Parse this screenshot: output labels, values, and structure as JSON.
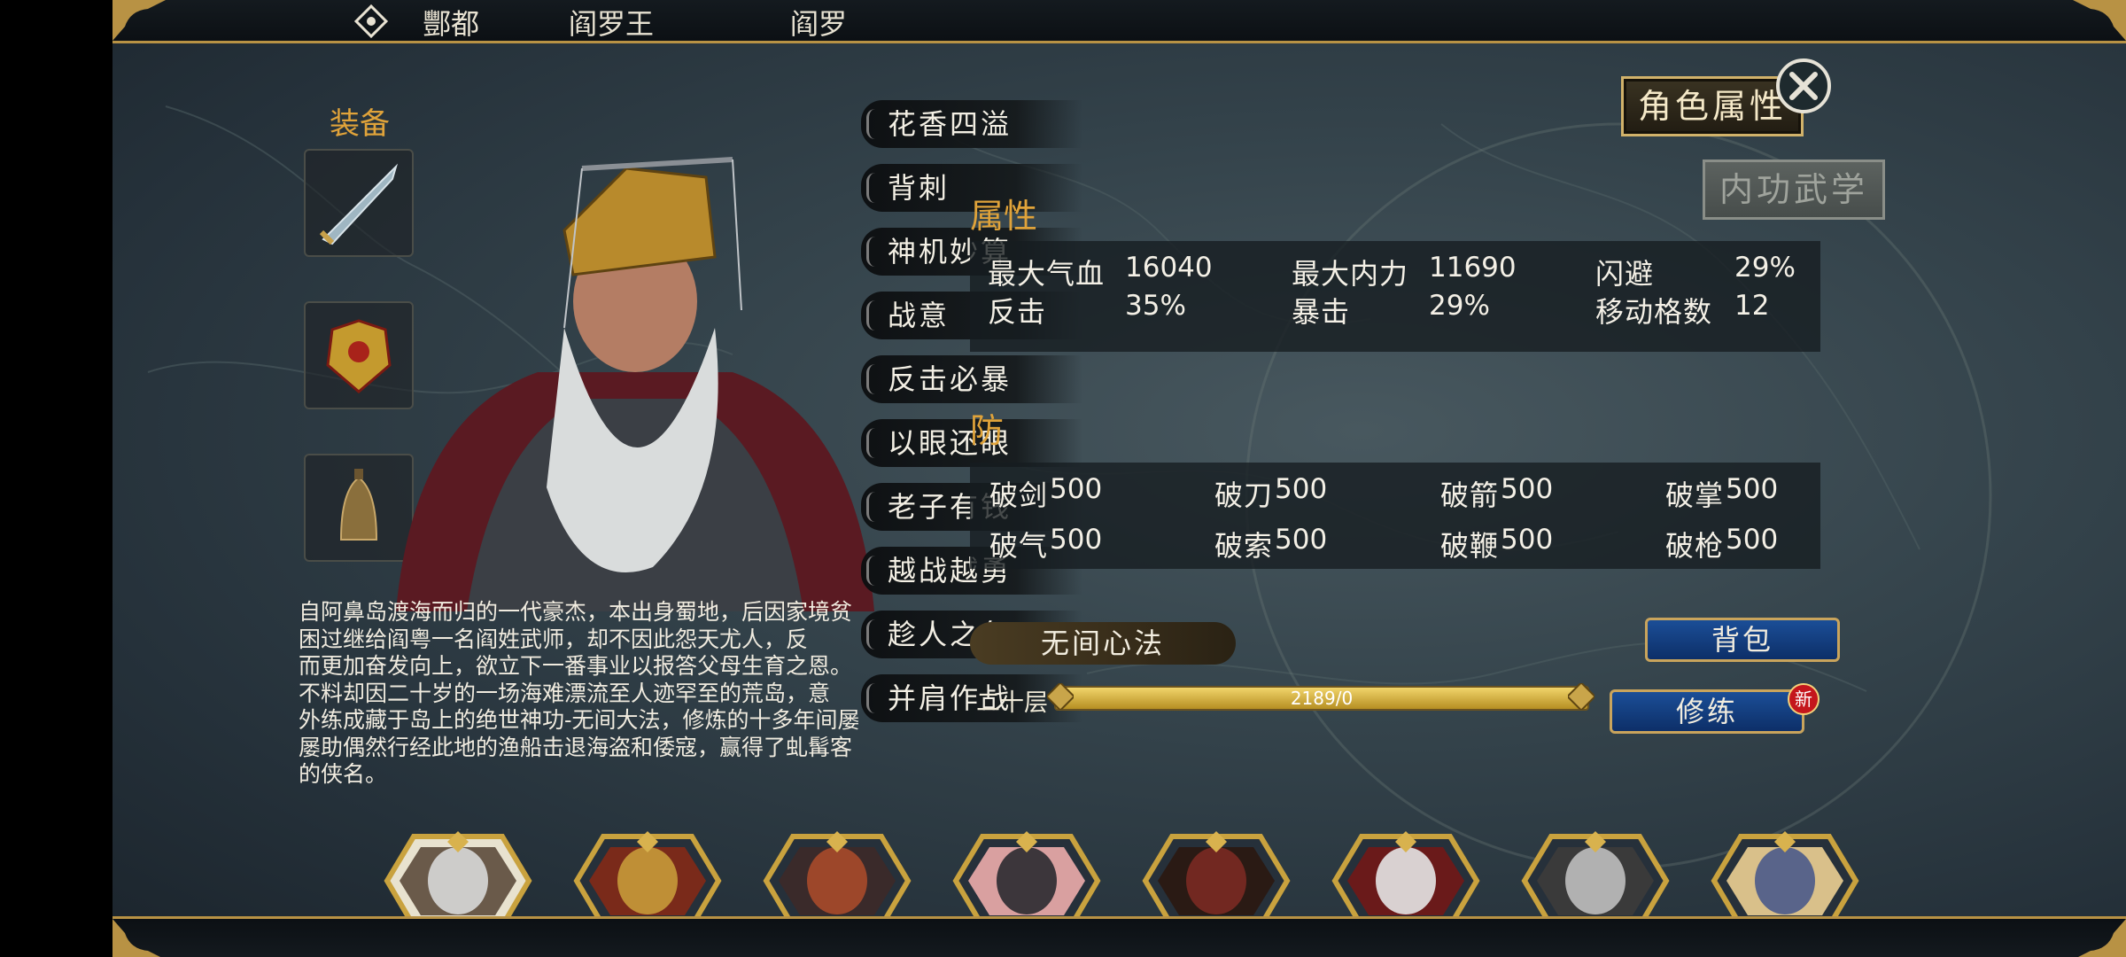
{
  "breadcrumb": {
    "items": [
      "酆都",
      "阎罗王",
      "阎罗"
    ]
  },
  "tabs": {
    "attributes_label": "角色属性",
    "martial_label": "内功武学"
  },
  "equipment": {
    "title": "装备",
    "slots": [
      "sword-icon",
      "armor-icon",
      "bell-icon"
    ]
  },
  "skills": [
    "花香四溢",
    "背刺",
    "神机妙算",
    "战意",
    "反击必暴",
    "以眼还眼",
    "老子有钱",
    "越战越勇",
    "趁人之危",
    "并肩作战"
  ],
  "description": "自阿鼻岛渡海而归的一代豪杰，本出身蜀地，后因家境贫困过继给阎粤一名阎姓武师，却不因此怨天尤人，反而更加奋发向上，欲立下一番事业以报答父母生育之恩。不料却因二十岁的一场海难漂流至人迹罕至的荒岛，意外练成藏于岛上的绝世神功-无间大法，修炼的十多年间屡屡助偶然行经此地的渔船击退海盗和倭寇，赢得了虬髯客的侠名。",
  "description_lines": [
    "自阿鼻岛渡海而归的一代豪杰，本出身蜀地，后因家境贫",
    "困过继给阎粤一名阎姓武师，却不因此怨天尤人，反",
    "而更加奋发向上，欲立下一番事业以报答父母生育之恩。",
    "不料却因二十岁的一场海难漂流至人迹罕至的荒岛，意",
    "外练成藏于岛上的绝世神功-无间大法，修炼的十多年间屡",
    "屡助偶然行经此地的渔船击退海盗和倭寇，赢得了虬髯客",
    "的侠名。"
  ],
  "attributes": {
    "title": "属性",
    "rows": [
      [
        {
          "label": "最大气血",
          "value": "16040"
        },
        {
          "label": "最大内力",
          "value": "11690"
        },
        {
          "label": "闪避",
          "value": "29%"
        }
      ],
      [
        {
          "label": "反击",
          "value": "35%"
        },
        {
          "label": "暴击",
          "value": "29%"
        },
        {
          "label": "移动格数",
          "value": "12"
        }
      ]
    ]
  },
  "defense": {
    "title": "防",
    "rows": [
      [
        {
          "label": "破剑",
          "value": "500"
        },
        {
          "label": "破刀",
          "value": "500"
        },
        {
          "label": "破箭",
          "value": "500"
        },
        {
          "label": "破掌",
          "value": "500"
        }
      ],
      [
        {
          "label": "破气",
          "value": "500"
        },
        {
          "label": "破索",
          "value": "500"
        },
        {
          "label": "破鞭",
          "value": "500"
        },
        {
          "label": "破枪",
          "value": "500"
        }
      ]
    ]
  },
  "inner_art": {
    "name": "无间心法",
    "level_label": "二十层",
    "progress_text": "2189/0",
    "progress_fraction": 1.0
  },
  "buttons": {
    "backpack": "背包",
    "train": "修练",
    "new_badge": "新"
  },
  "roster": {
    "count": 8,
    "selected_index": 0
  },
  "colors": {
    "gold": "#d1b26a",
    "orange_title": "#e0a33a",
    "blue_button": "#1b4e97",
    "new_badge": "#c4161c"
  }
}
